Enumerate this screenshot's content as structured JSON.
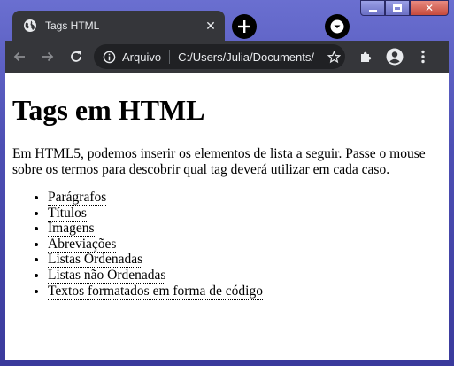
{
  "browser": {
    "tab": {
      "title": "Tags HTML"
    },
    "address_bar": {
      "security_label": "Arquivo",
      "url": "C:/Users/Julia/Documents/"
    }
  },
  "page": {
    "heading": "Tags em HTML",
    "intro": "Em HTML5, podemos inserir os elementos de lista a seguir. Passe o mouse sobre os termos para descobrir qual tag deverá utilizar em cada caso.",
    "items": [
      "Parágrafos",
      "Títulos",
      "Imagens",
      "Abreviações",
      "Listas Ordenadas",
      "Listas não Ordenadas",
      "Textos formatados em forma de código"
    ]
  }
}
